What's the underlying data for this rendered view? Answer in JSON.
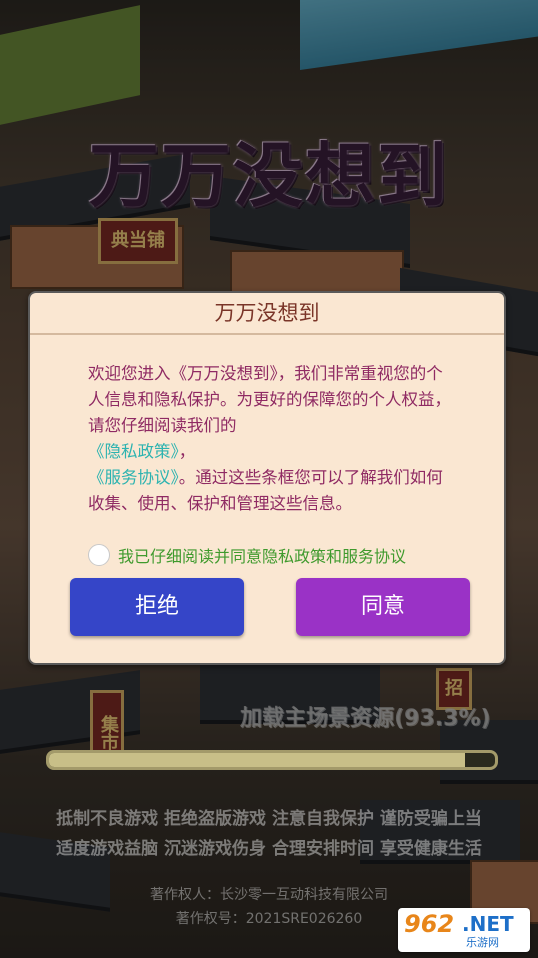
{
  "game": {
    "title": "万万没想到"
  },
  "scene_signs": {
    "pawnshop": "典当铺",
    "collect": "集市",
    "recruit": "招"
  },
  "dialog": {
    "title": "万万没想到",
    "body_intro": "欢迎您进入《万万没想到》，我们非常重视您的个人信息和隐私保护。为更好的保障您的个人权益，请您仔细阅读我们的",
    "privacy_link": "《隐私政策》",
    "separator": "，",
    "service_link": "《服务协议》",
    "body_outro": "。通过这些条框您可以了解我们如何收集、使用、保护和管理这些信息。",
    "agree_label": "我已仔细阅读并同意隐私政策和服务协议",
    "agree_checked": false,
    "reject_label": "拒绝",
    "accept_label": "同意"
  },
  "loading": {
    "text": "加载主场景资源(93.3%)",
    "progress": 0.933
  },
  "notice": {
    "line1": "抵制不良游戏 拒绝盗版游戏 注意自我保护 谨防受骗上当",
    "line2": "适度游戏益脑 沉迷游戏伤身 合理安排时间 享受健康生活"
  },
  "copyright": {
    "owner": "著作权人：长沙零一互动科技有限公司",
    "reg": "著作权号：2021SRE026260"
  },
  "watermark": {
    "num": "962",
    "net": ".NET",
    "cn": "乐游网"
  },
  "colors": {
    "reject": "#3545c8",
    "accept": "#9a32c6",
    "link": "#2db3b0",
    "body": "#8f2a63",
    "agree": "#3f9a2d"
  }
}
